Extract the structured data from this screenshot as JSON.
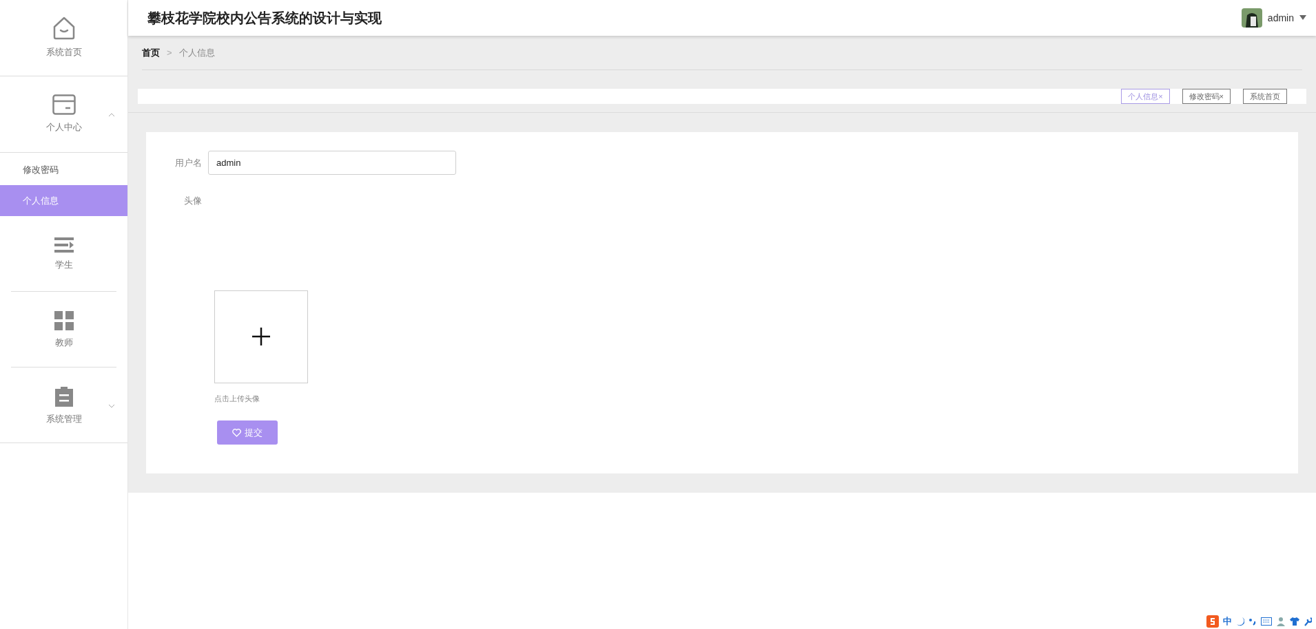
{
  "header": {
    "title": "攀枝花学院校内公告系统的设计与实现",
    "user": {
      "name": "admin"
    }
  },
  "sidebar": {
    "items": [
      {
        "label": "系统首页",
        "kind": "home"
      },
      {
        "label": "个人中心",
        "kind": "card",
        "expanded": true,
        "children": [
          {
            "label": "修改密码",
            "selected": false
          },
          {
            "label": "个人信息",
            "selected": true
          }
        ]
      },
      {
        "label": "学生",
        "kind": "list"
      },
      {
        "label": "教师",
        "kind": "grid"
      },
      {
        "label": "系统管理",
        "kind": "clipboard",
        "expanded": false
      }
    ]
  },
  "breadcrumb": [
    "首页",
    "个人信息"
  ],
  "breadcrumb_separator": ">",
  "tabs": [
    {
      "label": "个人信息",
      "close": "×",
      "selected": true
    },
    {
      "label": "修改密码",
      "close": "×",
      "selected": false
    },
    {
      "label": "系统首页",
      "selected": false
    }
  ],
  "form": {
    "username": {
      "label": "用户名",
      "value": "admin"
    },
    "avatar": {
      "label": "头像",
      "hint": "点击上传头像"
    },
    "submit": "提交"
  },
  "ime_toolbar": {
    "mode": "中"
  }
}
